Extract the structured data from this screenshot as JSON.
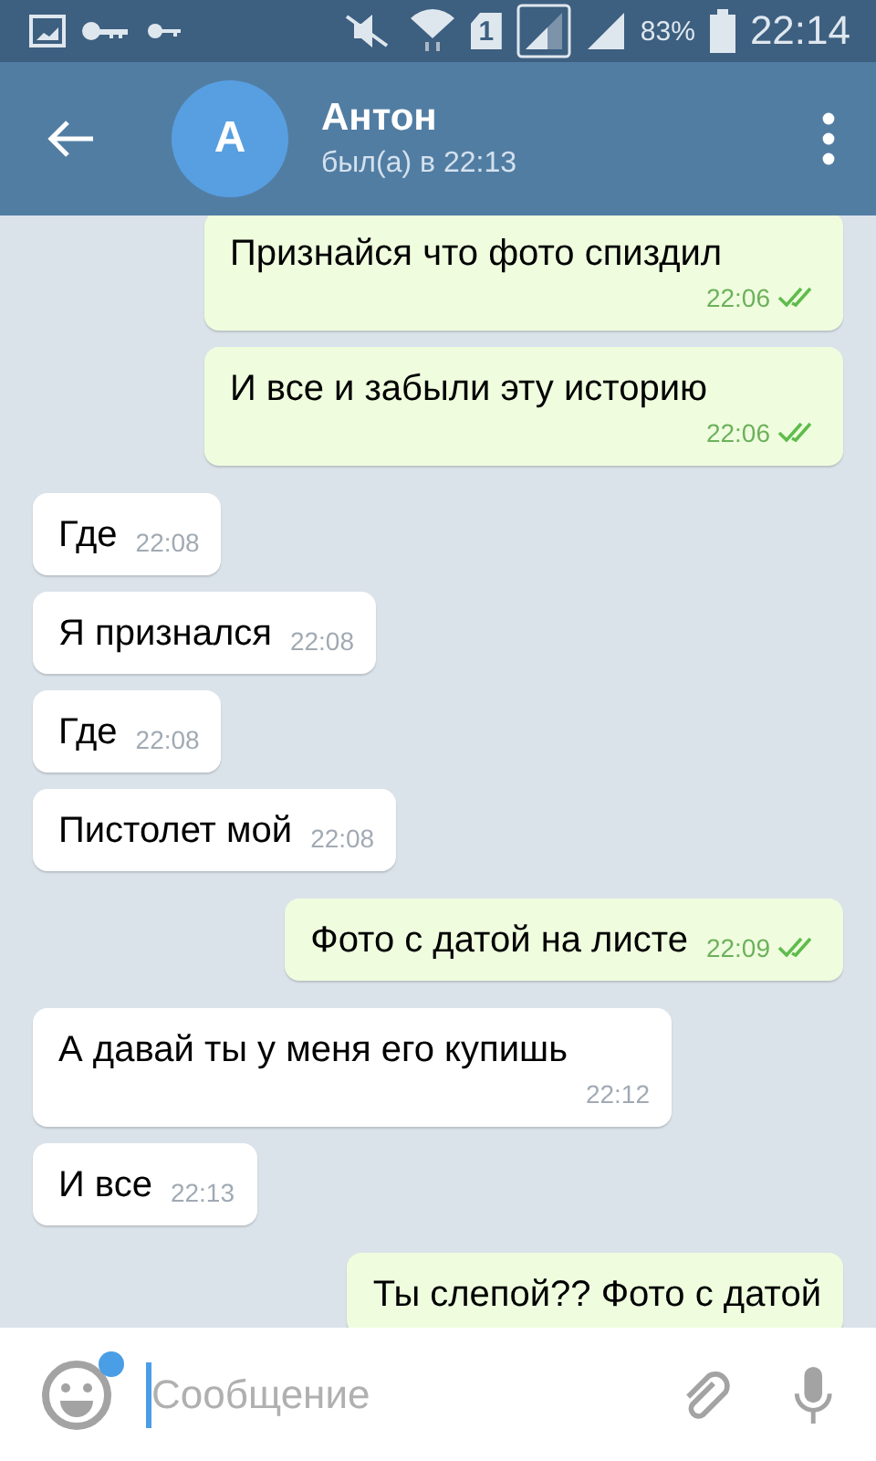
{
  "status_bar": {
    "sim": "1",
    "battery": "83%",
    "time": "22:14"
  },
  "header": {
    "avatar_letter": "А",
    "name": "Антон",
    "status": "был(а) в 22:13"
  },
  "messages": [
    {
      "kind": "outgoing",
      "text": "Признайся что фото спиздил",
      "time": "22:06",
      "read": true
    },
    {
      "kind": "outgoing",
      "text": "И все и забыли эту историю",
      "time": "22:06",
      "read": true
    },
    {
      "kind": "incoming",
      "text": "Где",
      "time": "22:08"
    },
    {
      "kind": "incoming",
      "text": "Я признался",
      "time": "22:08"
    },
    {
      "kind": "incoming",
      "text": "Где",
      "time": "22:08"
    },
    {
      "kind": "incoming",
      "text": "Пистолет мой",
      "time": "22:08"
    },
    {
      "kind": "outgoing",
      "text": "Фото с датой на листе",
      "time": "22:09",
      "read": true
    },
    {
      "kind": "incoming",
      "text": "А давай ты у меня его купишь",
      "time": "22:12"
    },
    {
      "kind": "incoming",
      "text": "И все",
      "time": "22:13"
    },
    {
      "kind": "outgoing",
      "text": "Ты слепой??  Фото с датой"
    }
  ],
  "composer": {
    "placeholder": "Сообщение",
    "emoji_badge": true
  }
}
